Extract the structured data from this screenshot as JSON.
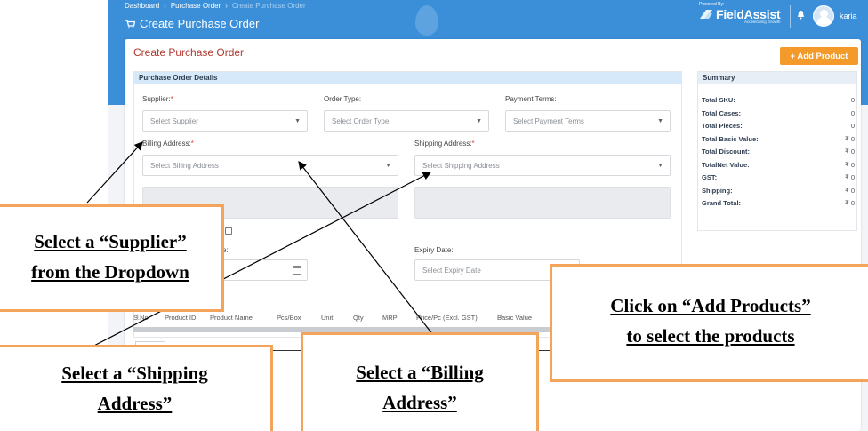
{
  "breadcrumb": [
    "Dashboard",
    "Purchase Order",
    "Create Purchase Order"
  ],
  "header": {
    "title": "Create Purchase Order",
    "brand": {
      "powered_by": "Powered By:",
      "name": "FieldAssist",
      "tagline": "Accelerating Growth"
    },
    "user_name": "karia"
  },
  "page": {
    "card_title": "Create Purchase Order",
    "add_product_label": "+ Add Product"
  },
  "details": {
    "section_title": "Purchase Order Details",
    "supplier": {
      "label": "Supplier:",
      "placeholder": "Select Supplier"
    },
    "order_type": {
      "label": "Order Type:",
      "placeholder": "Select Order Type:"
    },
    "payment_terms": {
      "label": "Payment Terms:",
      "placeholder": "Select Payment Terms"
    },
    "billing": {
      "label": "Billing Address:",
      "placeholder": "Select Billing Address"
    },
    "shipping": {
      "label": "Shipping Address:",
      "placeholder": "Select Shipping Address"
    },
    "partial_label": "e:",
    "expiry": {
      "label": "Expiry Date:",
      "placeholder": "Select Expiry Date"
    },
    "required_mark": "*"
  },
  "table": {
    "columns": [
      "S.No.",
      "Product ID",
      "Product Name",
      "Pcs/Box",
      "Unit",
      "Qty",
      "MRP",
      "Price/Pc (Excl. GST)",
      "Basic Value"
    ]
  },
  "summary": {
    "title": "Summary",
    "rows": [
      {
        "label": "Total SKU:",
        "value": "0"
      },
      {
        "label": "Total Cases:",
        "value": "0"
      },
      {
        "label": "Total Pieces:",
        "value": "0"
      },
      {
        "label": "Total Basic Value:",
        "value": "₹ 0"
      },
      {
        "label": "Total Discount:",
        "value": "₹ 0"
      },
      {
        "label": "TotalNet Value:",
        "value": "₹ 0"
      },
      {
        "label": "GST:",
        "value": "₹ 0"
      },
      {
        "label": "Shipping:",
        "value": "₹ 0"
      },
      {
        "label": "Grand Total:",
        "value": "₹ 0"
      }
    ]
  },
  "callouts": {
    "supplier": [
      "Select a “Supplier”",
      "from the Dropdown"
    ],
    "shipping": [
      "Select a “Shipping",
      "Address”"
    ],
    "billing": [
      "Select a “Billing",
      "Address”"
    ],
    "add_products": [
      "Click on “Add Products”",
      "to select the products"
    ]
  },
  "colors": {
    "header_blue": "#3a8fd8",
    "accent_orange": "#f39a2b",
    "title_red": "#b0382f",
    "callout_border": "#f4a45a"
  },
  "icons": {
    "title": "cart-icon",
    "bell": "bell-icon",
    "calendar": "calendar-icon",
    "caret": "chevron-down-icon",
    "sort": "sort-icon"
  }
}
